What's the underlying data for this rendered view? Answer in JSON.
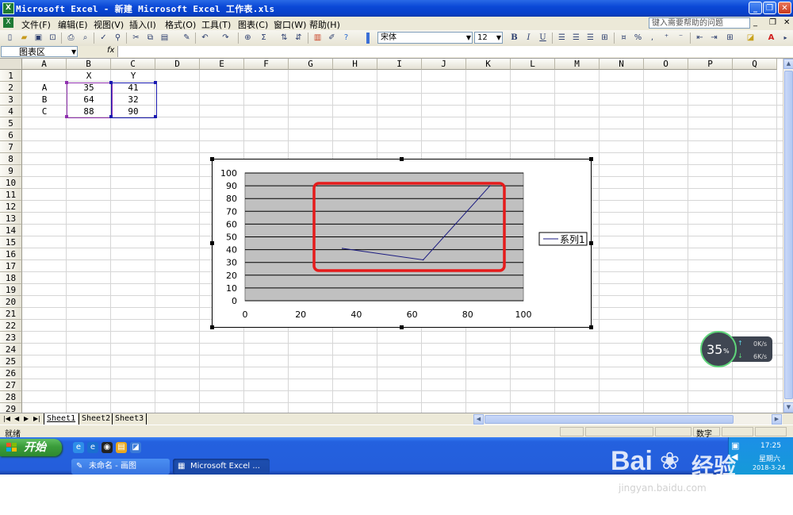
{
  "window": {
    "title": "Microsoft Excel - 新建 Microsoft Excel 工作表.xls",
    "app_icon": "X"
  },
  "menu": {
    "items": [
      "文件(F)",
      "编辑(E)",
      "视图(V)",
      "插入(I)",
      "格式(O)",
      "工具(T)",
      "图表(C)",
      "窗口(W)",
      "帮助(H)"
    ],
    "help_placeholder": "键入需要帮助的问题"
  },
  "toolbar": {
    "font_name": "宋体",
    "font_size": "12",
    "bold": "B",
    "italic": "I",
    "underline": "U"
  },
  "formula_bar": {
    "name_box": "图表区",
    "fx": "fx"
  },
  "grid": {
    "columns": [
      "A",
      "B",
      "C",
      "D",
      "E",
      "F",
      "G",
      "H",
      "I",
      "J",
      "K",
      "L",
      "M",
      "N",
      "O",
      "P",
      "Q"
    ],
    "rows": [
      "1",
      "2",
      "3",
      "4",
      "5",
      "6",
      "7",
      "8",
      "9",
      "10",
      "11",
      "12",
      "13",
      "14",
      "15",
      "16",
      "17",
      "18",
      "19",
      "20",
      "21",
      "22",
      "23",
      "24",
      "25",
      "26",
      "27",
      "28",
      "29"
    ],
    "cells": {
      "B1": "X",
      "C1": "Y",
      "A2": "A",
      "B2": "35",
      "C2": "41",
      "A3": "B",
      "B3": "64",
      "C3": "32",
      "A4": "C",
      "B4": "88",
      "C4": "90"
    }
  },
  "chart_data": {
    "type": "scatter",
    "series": [
      {
        "name": "系列1",
        "x": [
          35,
          64,
          88
        ],
        "y": [
          41,
          32,
          90
        ],
        "color": "#1a1a80"
      }
    ],
    "xlim": [
      0,
      100
    ],
    "ylim": [
      0,
      100
    ],
    "xticks": [
      "0",
      "20",
      "40",
      "60",
      "80",
      "100"
    ],
    "yticks": [
      "0",
      "10",
      "20",
      "30",
      "40",
      "50",
      "60",
      "70",
      "80",
      "90",
      "100"
    ],
    "title": "",
    "xlabel": "",
    "ylabel": "",
    "grid": true,
    "legend": "right",
    "plot_area_color": "#c0c0c0",
    "highlight_color": "#e51b1b"
  },
  "sheets": {
    "tabs": [
      "Sheet1",
      "Sheet2",
      "Sheet3"
    ],
    "active": "Sheet1"
  },
  "status": {
    "left": "就绪",
    "mode": "数字"
  },
  "taskbar": {
    "start_label": "开始",
    "buttons": [
      "未命名 - 画图",
      "Microsoft Excel ..."
    ],
    "clock": "17:25",
    "weekday": "星期六",
    "date": "2018-3-24"
  },
  "net_widget": {
    "percent": "35",
    "percent_unit": "%",
    "up": "0K/s",
    "down": "6K/s"
  },
  "watermark": {
    "brand_left": "Bai",
    "brand_right": "经验",
    "url": "jingyan.baidu.com"
  }
}
